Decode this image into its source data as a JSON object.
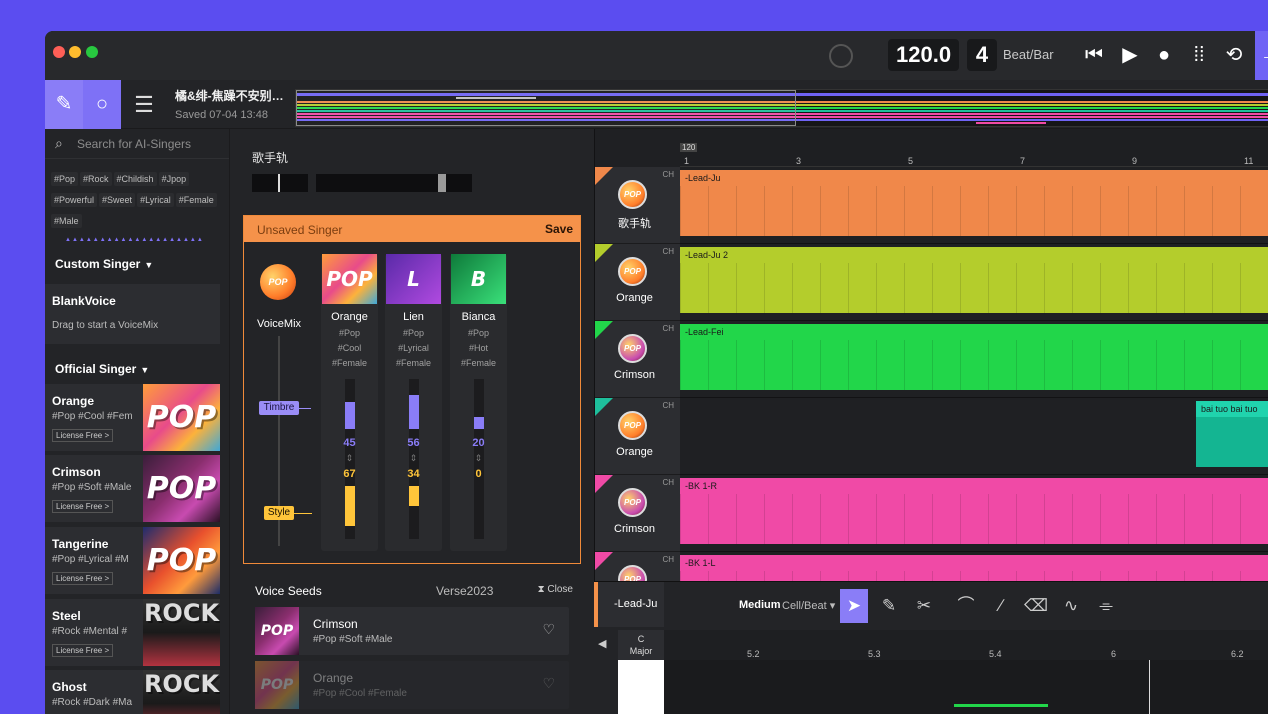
{
  "titlebar": {
    "tempo": "120.0",
    "beats": "4",
    "beat_label": "Beat/Bar",
    "icons": [
      "skip-back-icon",
      "play-icon",
      "record-icon",
      "grid-icon",
      "loop-icon",
      "export-icon"
    ]
  },
  "project": {
    "title": "橘&绯-焦躁不安别…",
    "saved": "Saved 07-04 13:48"
  },
  "sidebar": {
    "search_placeholder": "Search for AI-Singers",
    "tags": [
      "#Pop",
      "#Rock",
      "#Childish",
      "#Jpop",
      "#Powerful",
      "#Sweet",
      "#Lyrical",
      "#Female",
      "#Male"
    ],
    "custom_header": "Custom Singer",
    "blank": {
      "title": "BlankVoice",
      "hint": "Drag to start a VoiceMix"
    },
    "official_header": "Official Singer",
    "singers": [
      {
        "name": "Orange",
        "tags": "#Pop #Cool #Fem",
        "license": "License Free >",
        "cover": "POP"
      },
      {
        "name": "Crimson",
        "tags": "#Pop #Soft #Male",
        "license": "License Free >",
        "cover": "POP"
      },
      {
        "name": "Tangerine",
        "tags": "#Pop #Lyrical #M",
        "license": "License Free >",
        "cover": "POP"
      },
      {
        "name": "Steel",
        "tags": "#Rock #Mental #",
        "license": "License Free >",
        "cover": "ROCK"
      },
      {
        "name": "Ghost",
        "tags": "#Rock #Dark #Ma",
        "license": "",
        "cover": "ROCK"
      }
    ]
  },
  "middle": {
    "header": "歌手轨",
    "mixer": {
      "title": "Unsaved Singer",
      "save": "Save",
      "voicemix_label": "VoiceMix",
      "orb_text": "POP",
      "timbre": "Timbre",
      "style": "Style",
      "channels": [
        {
          "name": "Orange",
          "tags": [
            "#Pop",
            "#Cool",
            "#Female"
          ],
          "cover": "POP",
          "timbre": "45",
          "style": "67",
          "timbre_frac": 0.45,
          "style_frac": 0.67
        },
        {
          "name": "Lien",
          "tags": [
            "#Pop",
            "#Lyrical",
            "#Female"
          ],
          "cover": "L",
          "timbre": "56",
          "style": "34",
          "timbre_frac": 0.56,
          "style_frac": 0.34
        },
        {
          "name": "Bianca",
          "tags": [
            "#Pop",
            "#Hot",
            "#Female"
          ],
          "cover": "B",
          "timbre": "20",
          "style": "0",
          "timbre_frac": 0.2,
          "style_frac": 0.0
        }
      ]
    },
    "seeds": {
      "title": "Voice Seeds",
      "version": "Verse2023",
      "close": "Close",
      "items": [
        {
          "name": "Crimson",
          "tags": "#Pop #Soft #Male",
          "cover": "POP"
        },
        {
          "name": "Orange",
          "tags": "#Pop #Cool #Female",
          "cover": "POP"
        }
      ]
    }
  },
  "ruler": {
    "tempo_marker": "120",
    "bars": [
      "1",
      "3",
      "5",
      "7",
      "9",
      "11"
    ]
  },
  "tracks": [
    {
      "name": "歌手轨",
      "color": "#f0884a",
      "clip": "-Lead-Ju",
      "avatar": "POP"
    },
    {
      "name": "Orange",
      "color": "#b4cd2c",
      "clip": "-Lead-Ju 2",
      "avatar": "POP"
    },
    {
      "name": "Crimson",
      "color": "#22d64a",
      "clip": "-Lead-Fei",
      "avatar": "POP"
    },
    {
      "name": "Orange",
      "color": "#1ebf9c",
      "clip": "bai tuo bai tuo",
      "avatar": "POP"
    },
    {
      "name": "Crimson",
      "color": "#f04aa6",
      "clip": "-BK 1-R",
      "avatar": "POP"
    },
    {
      "name": "",
      "color": "#f04aa6",
      "clip": "-BK 1-L",
      "avatar": "POP"
    }
  ],
  "track_ch_label": "CH",
  "editor": {
    "track": "-Lead-Ju",
    "density": "Medium",
    "unit": "Cell/Beat",
    "key": [
      "C",
      "Major"
    ],
    "marks": [
      "5.2",
      "5.3",
      "5.4",
      "6",
      "6.2"
    ]
  }
}
